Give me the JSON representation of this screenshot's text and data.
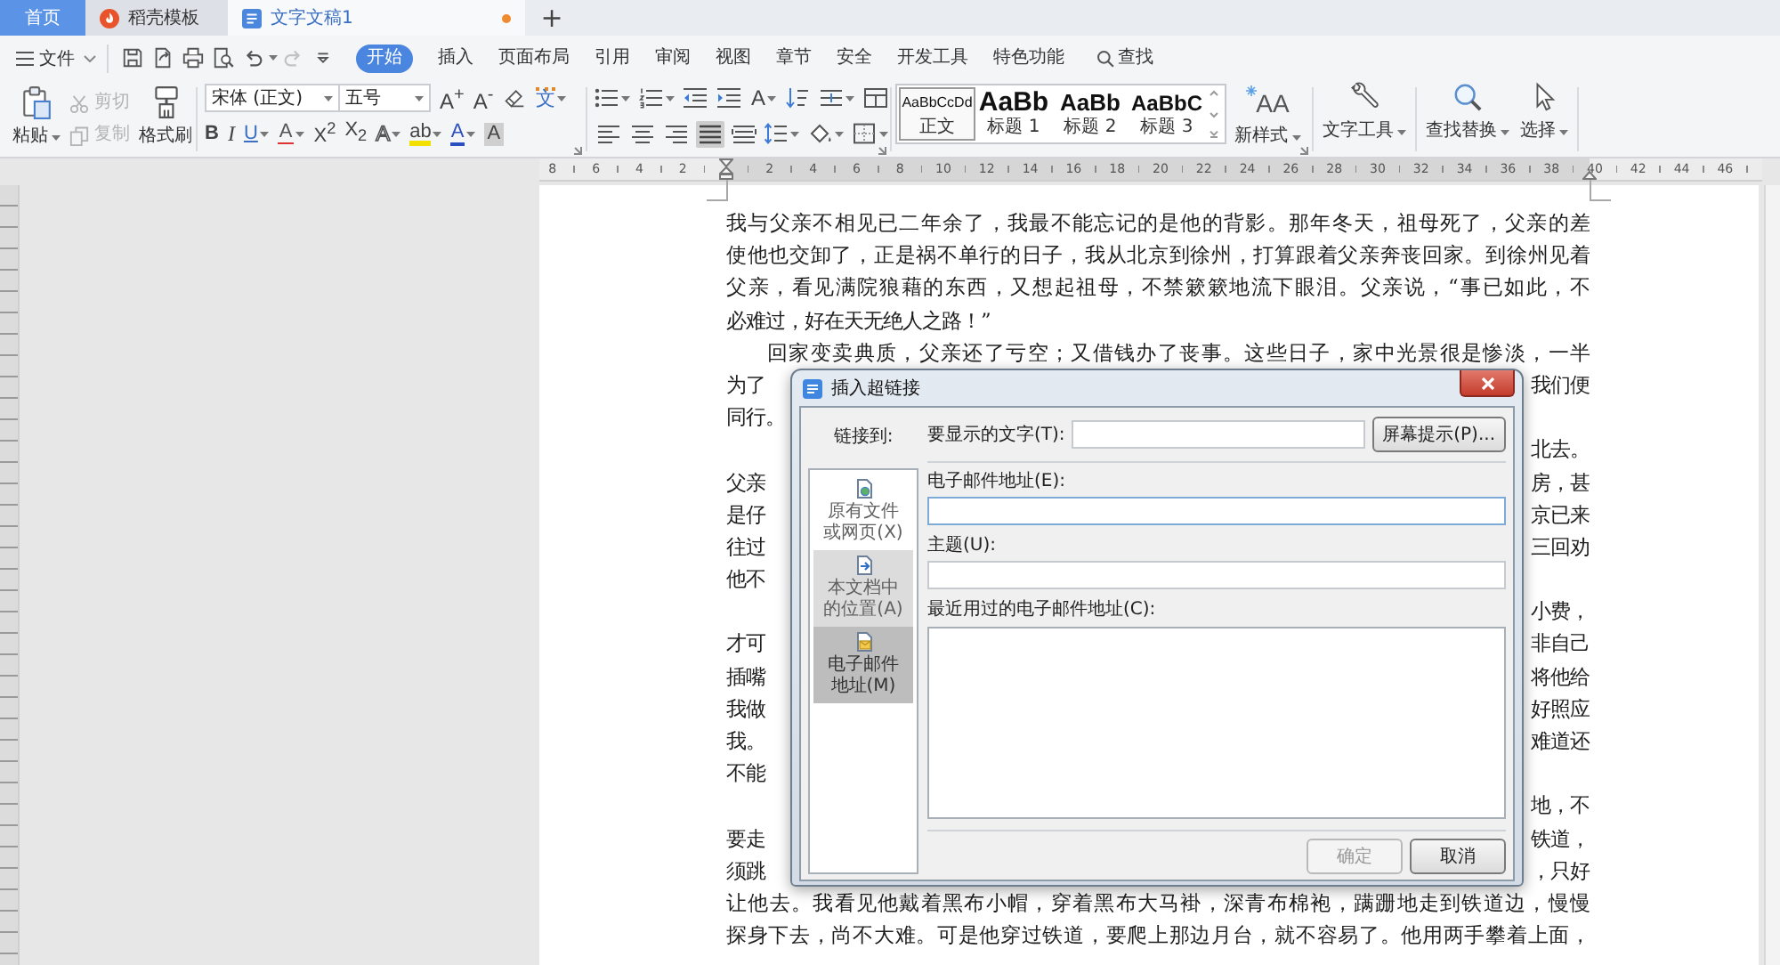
{
  "tab_bar": {
    "tabs": [
      {
        "label": "首页",
        "kind": "home",
        "selected": false,
        "unsaved": false
      },
      {
        "label": "稻壳模板",
        "kind": "template",
        "selected": false,
        "unsaved": false
      },
      {
        "label": "文字文稿1",
        "kind": "document",
        "selected": true,
        "unsaved": true
      }
    ],
    "new_tab": "+"
  },
  "menu_bar": {
    "file": "文件",
    "quick_access": [
      {
        "kind": "save",
        "disabled": false
      },
      {
        "kind": "export",
        "disabled": false
      },
      {
        "kind": "print",
        "disabled": false
      },
      {
        "kind": "preview",
        "disabled": false
      },
      {
        "kind": "undo",
        "disabled": false
      },
      {
        "kind": "redo",
        "disabled": true
      },
      {
        "kind": "customize",
        "disabled": false
      }
    ],
    "tabs": [
      {
        "label": "开始",
        "selected": true
      },
      {
        "label": "插入",
        "selected": false
      },
      {
        "label": "页面布局",
        "selected": false
      },
      {
        "label": "引用",
        "selected": false
      },
      {
        "label": "审阅",
        "selected": false
      },
      {
        "label": "视图",
        "selected": false
      },
      {
        "label": "章节",
        "selected": false
      },
      {
        "label": "安全",
        "selected": false
      },
      {
        "label": "开发工具",
        "selected": false
      },
      {
        "label": "特色功能",
        "selected": false
      }
    ],
    "search": "查找"
  },
  "toolbar": {
    "clipboard": {
      "paste": "粘贴",
      "cut": {
        "label": "剪切",
        "disabled": true
      },
      "copy": {
        "label": "复制",
        "disabled": true
      },
      "format_painter": "格式刷"
    },
    "font": {
      "name": "宋体 (正文)",
      "size": "五号",
      "row_1": [
        {
          "kind": "grow",
          "glyph": "A$^{+}$"
        },
        {
          "kind": "shrink",
          "glyph": "A$^{-}$"
        },
        {
          "kind": "clear"
        },
        {
          "kind": "pinyin",
          "glyph": "文"
        }
      ],
      "row_2": [
        {
          "kind": "bold",
          "glyph": "B"
        },
        {
          "kind": "italic",
          "glyph": "I"
        },
        {
          "kind": "underline",
          "glyph": "U"
        },
        {
          "kind": "strike",
          "glyph": "A"
        },
        {
          "kind": "superscript",
          "glyph": "X$^{2}$"
        },
        {
          "kind": "subscript",
          "glyph": "X$_{2}$"
        },
        {
          "kind": "effects",
          "glyph": "A"
        },
        {
          "kind": "highlight",
          "glyph": "ab"
        },
        {
          "kind": "color",
          "glyph": "A"
        },
        {
          "kind": "shading",
          "glyph": "A"
        }
      ]
    },
    "paragraph": {
      "direction": "A",
      "alignment": [
        {
          "kind": "left",
          "selected": false
        },
        {
          "kind": "center",
          "selected": false
        },
        {
          "kind": "right",
          "selected": false
        },
        {
          "kind": "justify",
          "selected": true
        },
        {
          "kind": "distribute",
          "selected": false
        }
      ]
    },
    "styles": [
      {
        "kind": "body",
        "sample": "AaBbCcDd",
        "label": "正文",
        "selected": true
      },
      {
        "kind": "heading_1",
        "sample": "AaBb",
        "label": "标题 1",
        "selected": false
      },
      {
        "kind": "heading_2",
        "sample": "AaBb",
        "label": "标题 2",
        "selected": false
      },
      {
        "kind": "heading_3",
        "sample": "AaBbC",
        "label": "标题 3",
        "selected": false
      }
    ],
    "big_buttons": [
      {
        "kind": "new_style",
        "glyph": "AA",
        "label": "新样式"
      },
      {
        "kind": "text_tools",
        "label": "文字工具"
      },
      {
        "kind": "find_replace",
        "label": "查找替换"
      },
      {
        "kind": "select",
        "label": "选择"
      }
    ]
  },
  "ruler": {
    "left_labels": [
      "8",
      "6",
      "4",
      "2"
    ],
    "right_labels": [
      "2",
      "4",
      "6",
      "8",
      "10",
      "12",
      "14",
      "16",
      "18",
      "20",
      "22",
      "24",
      "26",
      "28",
      "30",
      "32",
      "34",
      "36",
      "38",
      "40",
      "42",
      "44",
      "46"
    ]
  },
  "document": {
    "paragraphs": [
      {
        "indented": false,
        "lines": [
          {
            "kind": "full",
            "text": "我与父亲不相见已二年余了，我最不能忘记的是他的背影。那年冬天，祖母死了，父亲的差"
          },
          {
            "kind": "full",
            "text": "使他也交卸了，正是祸不单行的日子，我从北京到徐州，打算跟着父亲奔丧回家。到徐州见着"
          },
          {
            "kind": "full",
            "text": "父亲，看见满院狼藉的东西，又想起祖母，不禁簌簌地流下眼泪。父亲说，“事已如此，不"
          },
          {
            "kind": "end",
            "text": "必难过，好在天无绝人之路！”"
          }
        ]
      },
      {
        "indented": true,
        "lines": [
          {
            "kind": "full",
            "text": "回家变卖典质，父亲还了亏空；又借钱办了丧事。这些日子，家中光景很是惨淡，一半"
          },
          {
            "kind": "split",
            "left": "为了",
            "right": "我们便"
          },
          {
            "kind": "split",
            "left": "同行。"
          }
        ]
      },
      {
        "lines": [
          {
            "kind": "split",
            "right": "北去。"
          },
          {
            "kind": "split",
            "left": "父亲",
            "right": "房，甚"
          },
          {
            "kind": "split",
            "left": "是仔",
            "right": "京已来"
          },
          {
            "kind": "split",
            "left": "往过",
            "right": "三回劝"
          },
          {
            "kind": "split",
            "left": "他不"
          }
        ]
      },
      {
        "lines": [
          {
            "kind": "split",
            "right": "小费，"
          },
          {
            "kind": "split",
            "left": "才可",
            "right": "非自己"
          },
          {
            "kind": "split",
            "left": "插嘴",
            "right": "将他给"
          },
          {
            "kind": "split",
            "left": "我做",
            "right": "好照应"
          },
          {
            "kind": "split",
            "left": "我。",
            "right": "难道还"
          },
          {
            "kind": "split",
            "left": "不能"
          }
        ]
      },
      {
        "lines": [
          {
            "kind": "split",
            "right": "地，不"
          },
          {
            "kind": "split",
            "left": "要走",
            "right": "铁道，"
          },
          {
            "kind": "split",
            "left": "须跳",
            "right": "，只好"
          },
          {
            "kind": "full",
            "text": "让他去。我看见他戴着黑布小帽，穿着黑布大马褂，深青布棉袍，蹒跚地走到铁道边，慢慢"
          },
          {
            "kind": "full",
            "text": "探身下去，尚不大难。可是他穿过铁道，要爬上那边月台，就不容易了。他用两手攀着上面，"
          }
        ]
      }
    ]
  },
  "dialog": {
    "title": "插入超链接",
    "link_to": "链接到:",
    "display_text_label": "要显示的文字(T):",
    "screen_tip": "屏幕提示(P)...",
    "nav": [
      {
        "kind": "file",
        "label": "原有文件或网页(X)",
        "selected": false,
        "hovered": false
      },
      {
        "kind": "place",
        "label": "本文档中的位置(A)",
        "selected": false,
        "hovered": true
      },
      {
        "kind": "email",
        "label": "电子邮件地址(M)",
        "selected": true,
        "hovered": false
      }
    ],
    "fields": [
      {
        "label": "电子邮件地址(E):",
        "focused": true
      },
      {
        "label": "主题(U):",
        "focused": false
      }
    ],
    "recent_label": "最近用过的电子邮件地址(C):",
    "buttons": [
      {
        "label": "确定",
        "disabled": true
      },
      {
        "label": "取消",
        "disabled": false
      }
    ]
  }
}
